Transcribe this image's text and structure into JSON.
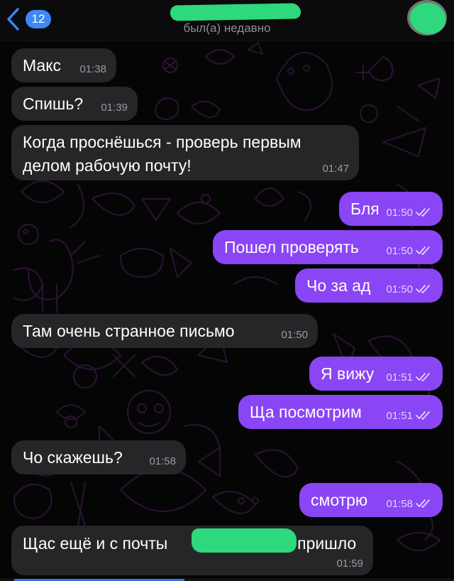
{
  "header": {
    "back_count": "12",
    "contact_status": "был(а) недавно"
  },
  "messages": [
    {
      "direction": "in",
      "text": "Макс",
      "time": "01:38"
    },
    {
      "direction": "in",
      "text": "Спишь?",
      "time": "01:39"
    },
    {
      "direction": "in",
      "text_line1": "Когда проснёшься - проверь первым",
      "text_line2": "делом рабочую почту!",
      "time": "01:47"
    },
    {
      "direction": "out",
      "text": "Бля",
      "time": "01:50",
      "status": "read"
    },
    {
      "direction": "out",
      "text": "Пошел проверять",
      "time": "01:50",
      "status": "read"
    },
    {
      "direction": "out",
      "text": "Чо за ад",
      "time": "01:50",
      "status": "read"
    },
    {
      "direction": "in",
      "text": "Там очень странное письмо",
      "time": "01:50"
    },
    {
      "direction": "out",
      "text": "Я вижу",
      "time": "01:51",
      "status": "read"
    },
    {
      "direction": "out",
      "text": "Ща посмотрим",
      "time": "01:51",
      "status": "read"
    },
    {
      "direction": "in",
      "text": "Чо скажешь?",
      "time": "01:58"
    },
    {
      "direction": "out",
      "text": "смотрю",
      "time": "01:58",
      "status": "read"
    },
    {
      "direction": "in",
      "text_before": "Щас ещё и с почты",
      "text_after": "а пришло",
      "time": "01:59"
    }
  ],
  "colors": {
    "incoming_bubble": "#262628",
    "outgoing_bubble": "#8a45f5",
    "accent": "#3e88f7",
    "redaction": "#2dd97c"
  }
}
